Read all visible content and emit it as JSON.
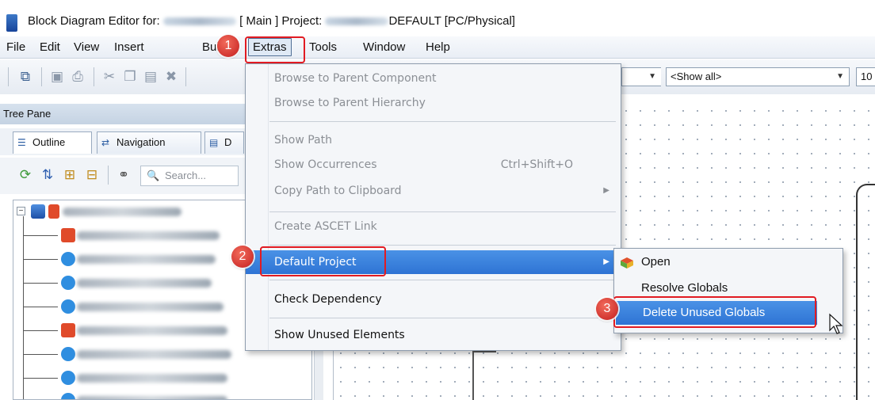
{
  "window": {
    "title_prefix": "Block Diagram Editor for:",
    "title_mid": "[ Main ] Project:",
    "title_suffix": "DEFAULT [PC/Physical]"
  },
  "menubar": {
    "items": [
      "File",
      "Edit",
      "View",
      "Insert",
      "Build",
      "Extras",
      "Tools",
      "Window",
      "Help"
    ]
  },
  "toolbar": {
    "filter_combo": "<Show all>",
    "zoom_fragment": "10"
  },
  "tree_pane": {
    "title": "Tree Pane",
    "tabs": [
      "Outline",
      "Navigation",
      "D"
    ],
    "search_placeholder": "Search..."
  },
  "extras_menu": {
    "items": [
      {
        "label": "Browse to Parent Component",
        "enabled": false
      },
      {
        "label": "Browse to Parent Hierarchy",
        "enabled": false
      },
      {
        "label": "Show Path",
        "enabled": false
      },
      {
        "label": "Show Occurrences",
        "shortcut": "Ctrl+Shift+O",
        "enabled": false
      },
      {
        "label": "Copy Path to Clipboard",
        "enabled": false,
        "submenu": true
      },
      {
        "label": "Create ASCET Link",
        "enabled": false
      },
      {
        "label": "Default Project",
        "enabled": true,
        "submenu": true,
        "highlighted": true
      },
      {
        "label": "Check Dependency",
        "enabled": true
      },
      {
        "label": "Show Unused Elements",
        "enabled": true
      }
    ]
  },
  "default_project_submenu": {
    "items": [
      {
        "label": "Open",
        "icon": "open-icon"
      },
      {
        "label": "Resolve Globals"
      },
      {
        "label": "Delete Unused Globals",
        "highlighted": true
      }
    ]
  },
  "callouts": [
    "1",
    "2",
    "3"
  ],
  "colors": {
    "highlight": "#2e73d4",
    "callout_red": "#c41e1e",
    "redbox": "#e11b22"
  }
}
